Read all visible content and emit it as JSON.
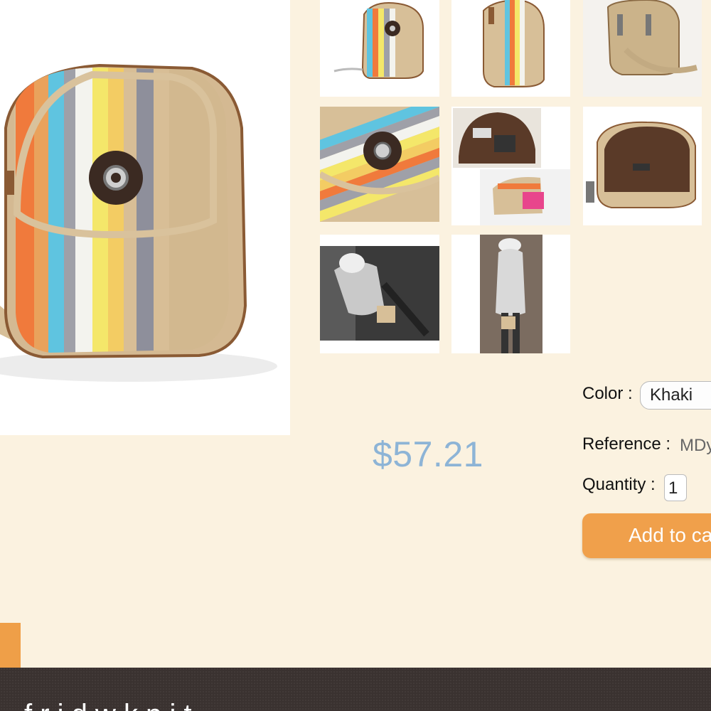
{
  "product": {
    "price": "$57.21",
    "color_label": "Color :",
    "color_value": "Khaki",
    "reference_label": "Reference :",
    "reference_value": "MDy",
    "quantity_label": "Quantity :",
    "quantity_value": "1",
    "add_to_cart_label": "Add to ca"
  },
  "thumbnails": [
    {
      "name": "thumb-bag-front"
    },
    {
      "name": "thumb-bag-side"
    },
    {
      "name": "thumb-bag-back"
    },
    {
      "name": "thumb-bag-closeup"
    },
    {
      "name": "thumb-bag-interior-items"
    },
    {
      "name": "thumb-bag-interior"
    },
    {
      "name": "thumb-model-street"
    },
    {
      "name": "thumb-model-standing"
    }
  ],
  "footer": {
    "text": "f  r  i  d  w     k  p  i  t"
  },
  "colors": {
    "background": "#fbf2e0",
    "price": "#8db4d6",
    "button": "#f0a04b",
    "footer": "#3a3230"
  }
}
